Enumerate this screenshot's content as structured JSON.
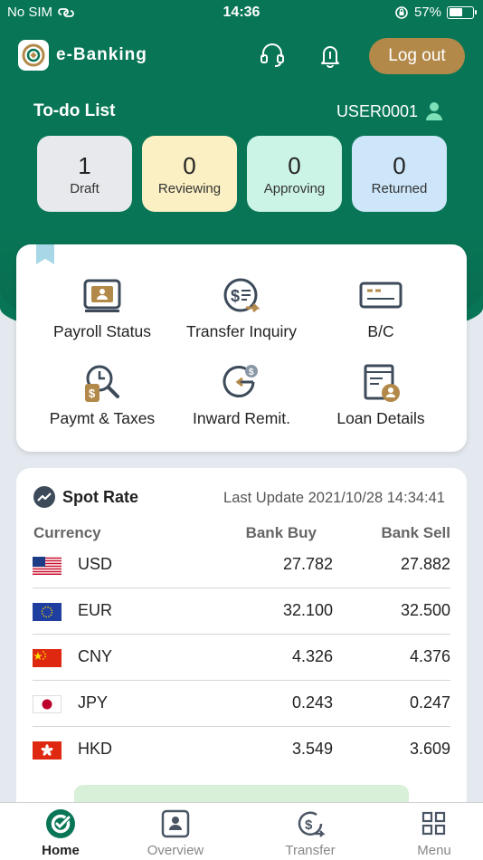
{
  "status_bar": {
    "carrier": "No SIM",
    "time": "14:36",
    "battery": "57%",
    "battery_level": 0.57
  },
  "header": {
    "brand": "e-Banking",
    "logout_label": "Log out"
  },
  "todo": {
    "title": "To-do List",
    "user": "USER0001",
    "cards": [
      {
        "count": "1",
        "label": "Draft",
        "color": "#e7e9ec"
      },
      {
        "count": "0",
        "label": "Reviewing",
        "color": "#fbf0c3"
      },
      {
        "count": "0",
        "label": "Approving",
        "color": "#ccf4e6"
      },
      {
        "count": "0",
        "label": "Returned",
        "color": "#cde6f9"
      }
    ]
  },
  "services": [
    {
      "label": "Payroll Status",
      "icon": "payroll-icon"
    },
    {
      "label": "Transfer Inquiry",
      "icon": "transfer-inquiry-icon"
    },
    {
      "label": "B/C",
      "icon": "bill-card-icon"
    },
    {
      "label": "Paymt & Taxes",
      "icon": "payment-taxes-icon"
    },
    {
      "label": "Inward Remit.",
      "icon": "inward-remittance-icon"
    },
    {
      "label": "Loan Details",
      "icon": "loan-details-icon"
    }
  ],
  "spot_rate": {
    "title": "Spot Rate",
    "last_update": "Last Update 2021/10/28 14:34:41",
    "headers": {
      "currency": "Currency",
      "buy": "Bank Buy",
      "sell": "Bank Sell"
    },
    "rows": [
      {
        "currency": "USD",
        "buy": "27.782",
        "sell": "27.882"
      },
      {
        "currency": "EUR",
        "buy": "32.100",
        "sell": "32.500"
      },
      {
        "currency": "CNY",
        "buy": "4.326",
        "sell": "4.376"
      },
      {
        "currency": "JPY",
        "buy": "0.243",
        "sell": "0.247"
      },
      {
        "currency": "HKD",
        "buy": "3.549",
        "sell": "3.609"
      }
    ]
  },
  "tabs": [
    {
      "label": "Home",
      "icon": "home-icon",
      "active": true
    },
    {
      "label": "Overview",
      "icon": "overview-icon",
      "active": false
    },
    {
      "label": "Transfer",
      "icon": "transfer-icon",
      "active": false
    },
    {
      "label": "Menu",
      "icon": "menu-grid-icon",
      "active": false
    }
  ],
  "colors": {
    "primary": "#087656",
    "gold": "#b3894a",
    "icon_dark": "#3c4a5a"
  }
}
